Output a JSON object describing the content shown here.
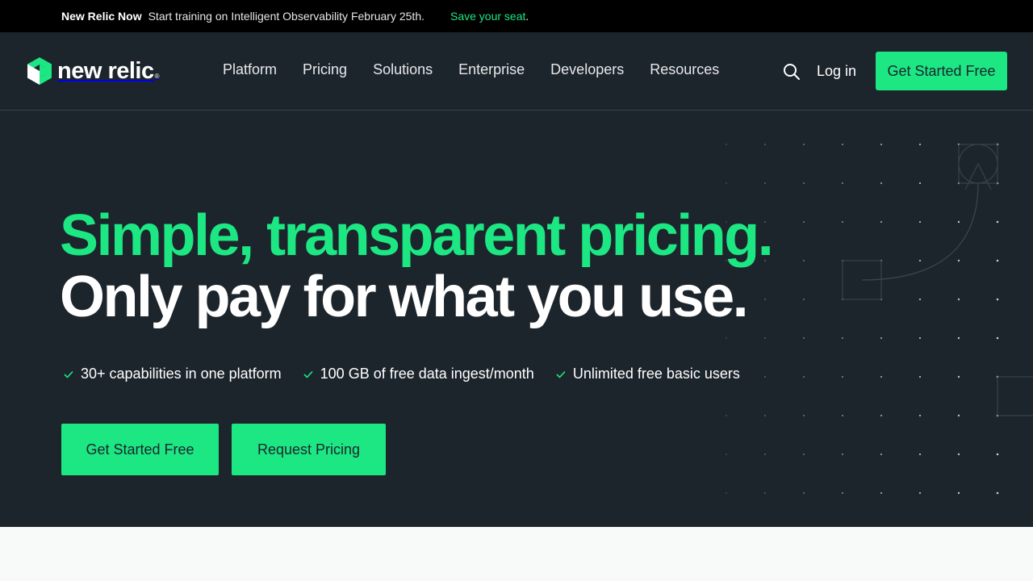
{
  "announcement": {
    "brand": "New Relic Now",
    "message": "Start training on Intelligent Observability February 25th.",
    "link_text": "Save your seat",
    "link_suffix": "."
  },
  "nav": {
    "logo_text": "new relic",
    "logo_mark": "®",
    "links": [
      "Platform",
      "Pricing",
      "Solutions",
      "Enterprise",
      "Developers",
      "Resources"
    ],
    "login": "Log in",
    "cta": "Get Started Free"
  },
  "hero": {
    "headline_green": "Simple, transparent pricing.",
    "headline_white": "Only pay for what you use.",
    "features": [
      "30+ capabilities in one platform",
      "100 GB of free data ingest/month",
      "Unlimited free basic users"
    ],
    "primary_button": "Get Started Free",
    "secondary_button": "Request Pricing"
  },
  "colors": {
    "accent": "#1ce783",
    "dark_bg": "#1d252c",
    "announcement_bg": "#000000",
    "light_bg": "#f8faf9"
  }
}
